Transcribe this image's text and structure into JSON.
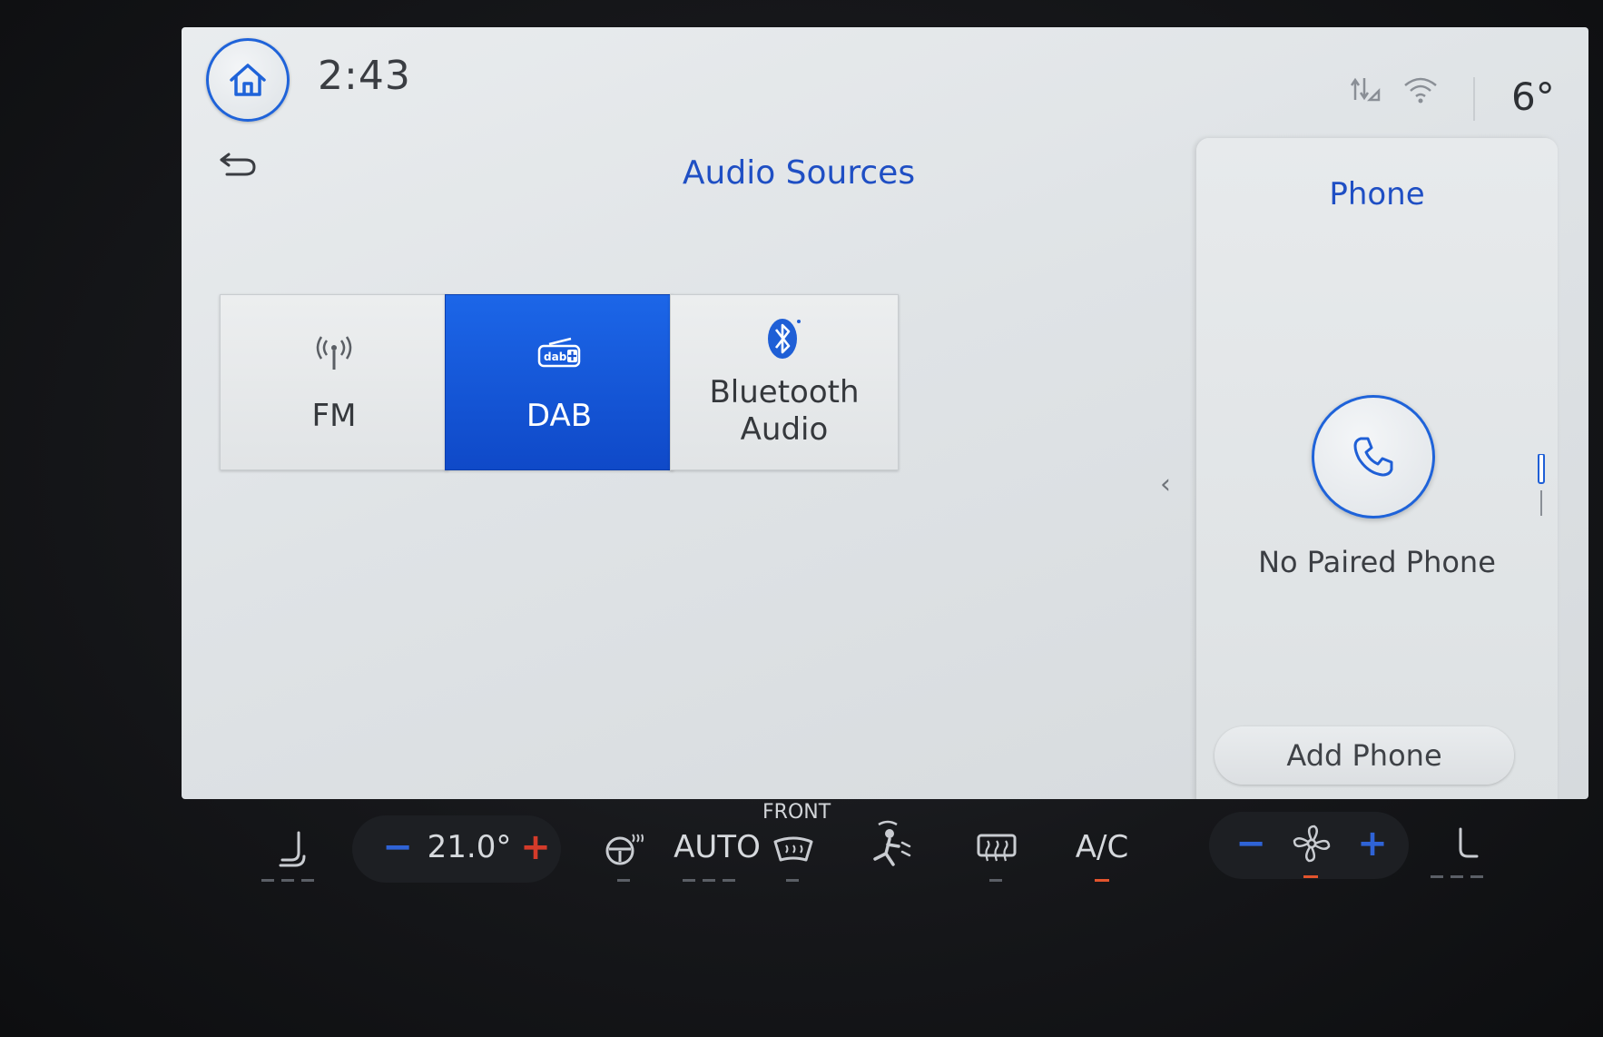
{
  "status_bar": {
    "time": "2:43",
    "outside_temp": "6°",
    "icons": [
      "home-icon",
      "signal-off-icon",
      "wifi-icon"
    ]
  },
  "audio": {
    "title": "Audio Sources",
    "sources": [
      {
        "label": "FM",
        "icon": "antenna-icon",
        "active": false
      },
      {
        "label": "DAB",
        "icon": "dab-plus-icon",
        "active": true
      },
      {
        "label": "Bluetooth\nAudio",
        "icon": "bluetooth-icon",
        "active": false
      }
    ]
  },
  "phone": {
    "title": "Phone",
    "status": "No Paired Phone",
    "add_button": "Add Phone"
  },
  "climate": {
    "temperature": "21.0°",
    "auto_label": "AUTO",
    "front_label": "FRONT",
    "ac_label": "A/C",
    "colors": {
      "minus": "#2f63d6",
      "plus": "#d43b2a",
      "indicator_on": "#e2542d"
    }
  }
}
